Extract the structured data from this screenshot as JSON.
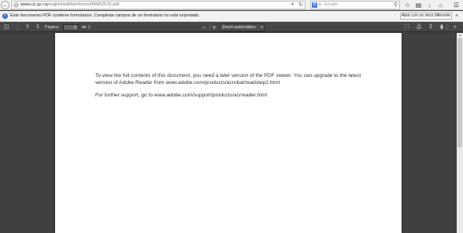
{
  "browser": {
    "url_host": "www.cic.gc.ca",
    "url_path": "/english/pdf/kits/forms/IMM5257E.pdf",
    "search_placeholder": "Google",
    "search_engine_glyph": "8"
  },
  "notification": {
    "message": "Este documento PDF contiene formularios. Completar campos de un formulario no está soportado.",
    "button_label": "Abrir con un visor diferente"
  },
  "pdf_toolbar": {
    "page_label": "Página:",
    "page_value": "1",
    "page_total": "de 1",
    "zoom_label": "Zoom automático"
  },
  "document": {
    "paragraph1": "To view the full contents of this document, you need a later version of the PDF viewer. You can upgrade to the latest version of Adobe Reader from www.adobe.com/products/acrobat/readstep2.html",
    "paragraph2": "For further support, go to www.adobe.com/support/products/acrreader.html"
  },
  "colors": {
    "viewer_bg": "#404040",
    "toolbar_bg": "#474747",
    "notification_bg": "#f2f2f2",
    "info_icon": "#3b6fbf"
  }
}
